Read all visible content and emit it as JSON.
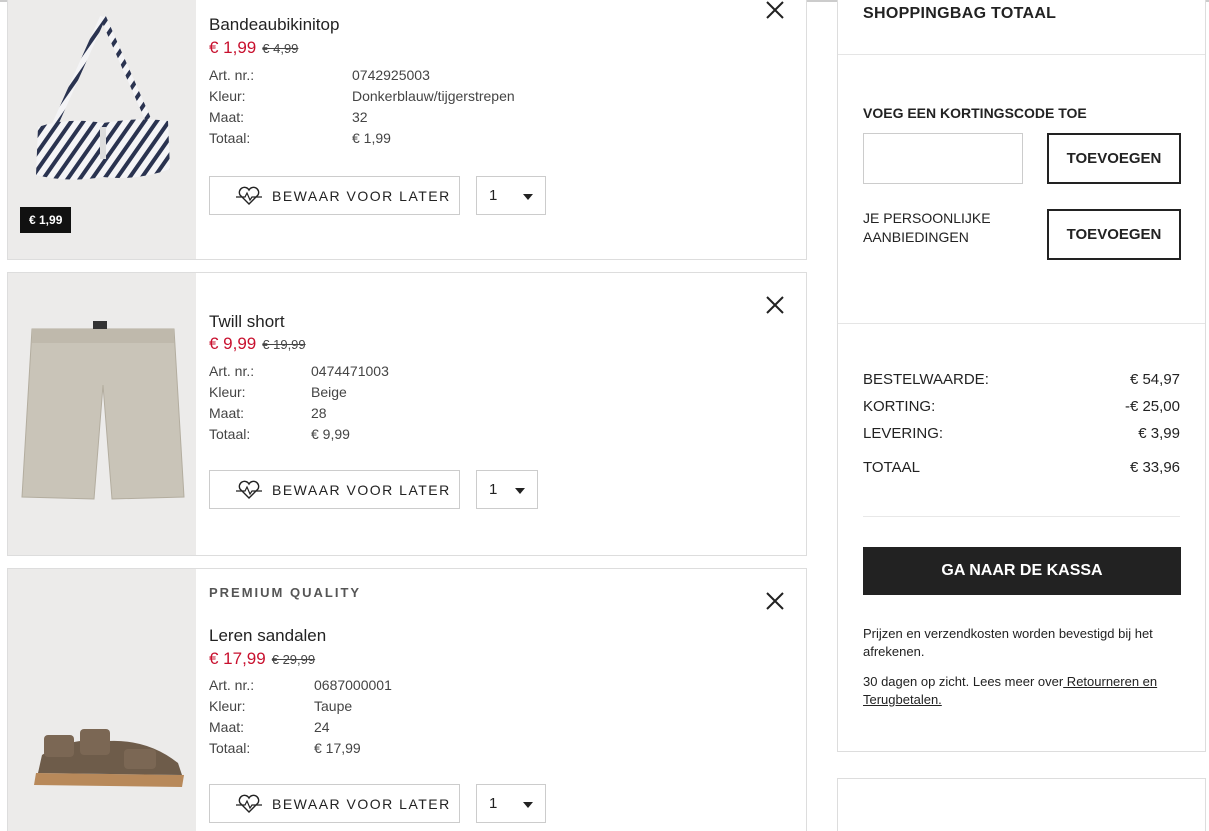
{
  "items": [
    {
      "premium": "",
      "name": "Bandeaubikinitop",
      "sale_price": "€ 1,99",
      "old_price": "€ 4,99",
      "badge": "€ 1,99",
      "labels": {
        "art": "Art. nr.:",
        "color": "Kleur:",
        "size": "Maat:",
        "total": "Totaal:"
      },
      "art_nr": "0742925003",
      "color": "Donkerblauw/tijgerstrepen",
      "size": "32",
      "total": "€ 1,99",
      "save_label": "BEWAAR VOOR LATER",
      "qty": "1",
      "icons": {
        "close": "close-icon",
        "save": "heart-icon"
      }
    },
    {
      "premium": "",
      "name": "Twill short",
      "sale_price": "€ 9,99",
      "old_price": "€ 19,99",
      "labels": {
        "art": "Art. nr.:",
        "color": "Kleur:",
        "size": "Maat:",
        "total": "Totaal:"
      },
      "art_nr": "0474471003",
      "color": "Beige",
      "size": "28",
      "total": "€ 9,99",
      "save_label": "BEWAAR VOOR LATER",
      "qty": "1"
    },
    {
      "premium": "PREMIUM QUALITY",
      "name": "Leren sandalen",
      "sale_price": "€ 17,99",
      "old_price": "€ 29,99",
      "labels": {
        "art": "Art. nr.:",
        "color": "Kleur:",
        "size": "Maat:",
        "total": "Totaal:"
      },
      "art_nr": "0687000001",
      "color": "Taupe",
      "size": "24",
      "total": "€ 17,99",
      "save_label": "BEWAAR VOOR LATER",
      "qty": "1"
    }
  ],
  "summary": {
    "title": "SHOPPINGBAG TOTAAL",
    "code_label": "VOEG EEN KORTINGSCODE TOE",
    "code_placeholder": "",
    "code_button": "TOEVOEGEN",
    "offers_label": "JE PERSOONLIJKE AANBIEDINGEN",
    "offers_button": "TOEVOEGEN",
    "rows": [
      {
        "label": "BESTELWAARDE:",
        "value": "€ 54,97"
      },
      {
        "label": "KORTING:",
        "value": "-€ 25,00"
      },
      {
        "label": "LEVERING:",
        "value": "€ 3,99"
      },
      {
        "label": "TOTAAL",
        "value": "€ 33,96"
      }
    ],
    "checkout_label": "GA NAAR DE KASSA",
    "note1": "Prijzen en verzendkosten worden bevestigd bij het afrekenen.",
    "note2_prefix": "30 dagen op zicht. Lees meer over",
    "note2_link": " Retourneren en Terugbetalen."
  },
  "colors": {
    "sale": "#c8102e",
    "dark": "#222222",
    "border": "#dddddd"
  }
}
